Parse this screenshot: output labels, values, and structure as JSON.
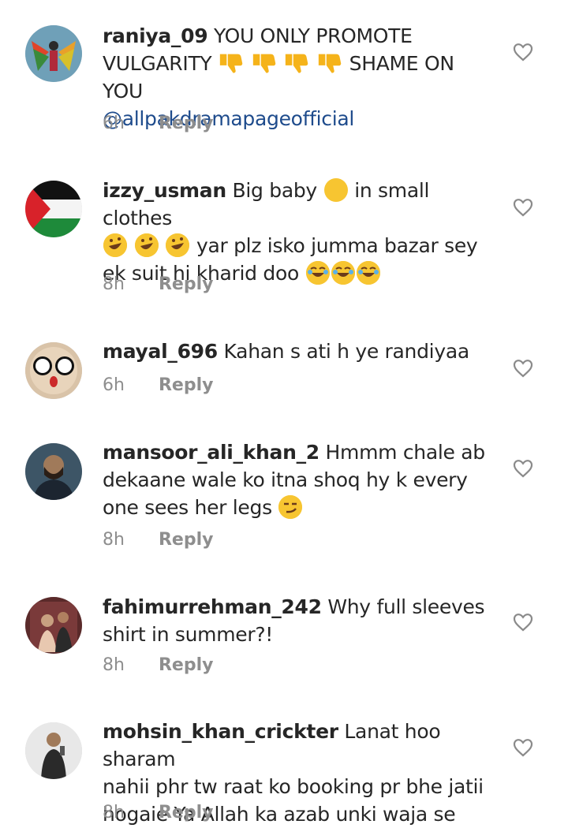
{
  "comments": [
    {
      "username": "raniya_09",
      "line1": "YOU ONLY PROMOTE",
      "line2a": "VULGARITY",
      "emojis": "4x thumbs-down",
      "line2b": "SHAME ON YOU",
      "mention": "@allpakdramapageofficial",
      "time": "6h",
      "reply": "Reply"
    },
    {
      "username": "izzy_usman",
      "line1a": "Big baby",
      "line1b": "in small clothes",
      "line2": "yar plz isko jumma bazar sey",
      "line3": "ek suit hi kharid doo",
      "time": "8h",
      "reply": "Reply"
    },
    {
      "username": "mayal_696",
      "line1": "Kahan s ati h ye randiyaa",
      "time": "6h",
      "reply": "Reply"
    },
    {
      "username": "mansoor_ali_khan_2",
      "line1": "Hmmm chale ab",
      "line2": "dekaane wale ko itna shoq hy k every",
      "line3": "one sees her legs",
      "time": "8h",
      "reply": "Reply"
    },
    {
      "username": "fahimurrehman_242",
      "line1": "Why full sleeves",
      "line2": "shirt in summer?!",
      "time": "8h",
      "reply": "Reply"
    },
    {
      "username": "mohsin_khan_crickter",
      "line1": "Lanat hoo sharam",
      "line2": "nahii phr tw raat ko booking pr bhe jatii",
      "line3": "hogaie Ya Allah ka azab unki waja se",
      "time": "8h",
      "reply": "Reply"
    }
  ],
  "colors": {
    "text": "#262626",
    "meta": "#8e8e8e",
    "mention": "#1e4b8c",
    "emoji": "#f7c531"
  },
  "icons": {
    "like": "heart-outline-icon"
  }
}
